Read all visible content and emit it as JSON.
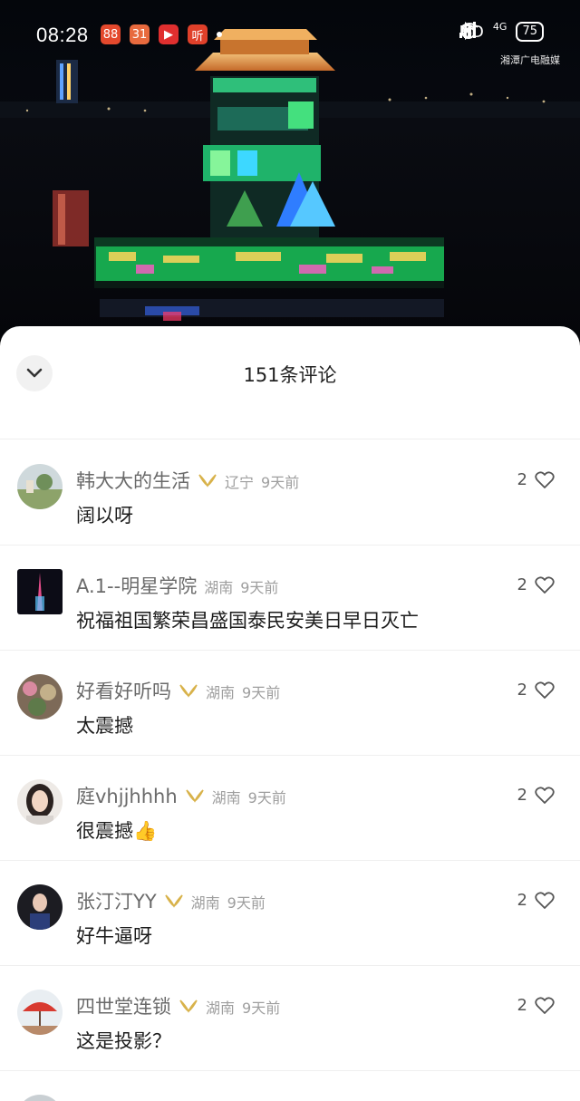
{
  "status_bar": {
    "time": "08:28",
    "apps": [
      {
        "glyph": "88",
        "color": "#e4492d"
      },
      {
        "glyph": "31",
        "color": "#e86a3e"
      },
      {
        "glyph": "▶",
        "color": "#e02f2f"
      },
      {
        "glyph": "听",
        "color": "#e0402a"
      }
    ],
    "network": "HD",
    "cell": "4G",
    "battery": "75",
    "watermark": "湘潭广电融媒"
  },
  "sheet": {
    "title": "151条评论"
  },
  "comments": [
    {
      "user": "韩大大的生活",
      "has_badge": true,
      "region": "辽宁",
      "ago": "9天前",
      "text": "阔以呀",
      "likes": "2",
      "avatar": "landscape"
    },
    {
      "user": "A.1--明星学院",
      "has_badge": false,
      "region": "湖南",
      "ago": "9天前",
      "text": "祝福祖国繁荣昌盛国泰民安美日早日灭亡",
      "likes": "2",
      "avatar": "tower"
    },
    {
      "user": "好看好听吗",
      "has_badge": true,
      "region": "湖南",
      "ago": "9天前",
      "text": "太震撼",
      "likes": "2",
      "avatar": "flowers"
    },
    {
      "user": "庭vhjjhhhh",
      "has_badge": true,
      "region": "湖南",
      "ago": "9天前",
      "text": "很震撼👍",
      "likes": "2",
      "avatar": "woman"
    },
    {
      "user": "张汀汀YY",
      "has_badge": true,
      "region": "湖南",
      "ago": "9天前",
      "text": "好牛逼呀",
      "likes": "2",
      "avatar": "portrait"
    },
    {
      "user": "四世堂连锁",
      "has_badge": true,
      "region": "湖南",
      "ago": "9天前",
      "text": "这是投影？",
      "likes": "2",
      "avatar": "umbrella"
    }
  ],
  "colors": {
    "accent_badge": "#d8b24a",
    "sheet_bg": "#ffffff"
  },
  "icons": {
    "collapse": "chevron-down-icon",
    "like": "heart-outline-icon",
    "badge": "wing-badge-icon"
  }
}
